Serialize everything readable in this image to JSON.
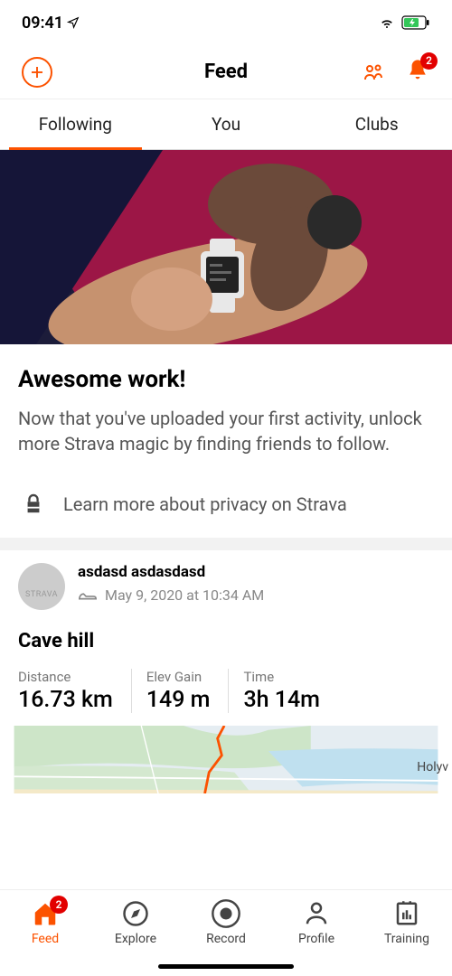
{
  "status": {
    "time": "09:41"
  },
  "header": {
    "title": "Feed",
    "notification_count": "2"
  },
  "tabs": {
    "following": "Following",
    "you": "You",
    "clubs": "Clubs"
  },
  "promo": {
    "title": "Awesome work!",
    "body": "Now that you've uploaded your first activity, unlock more Strava magic by finding friends to follow.",
    "privacy": "Learn more about privacy on Strava"
  },
  "activity": {
    "avatar_text": "STRAVA",
    "user": "asdasd asdasdasd",
    "timestamp": "May 9, 2020 at 10:34 AM",
    "title": "Cave hill",
    "stats": {
      "distance_label": "Distance",
      "distance_value": "16.73 km",
      "elev_label": "Elev Gain",
      "elev_value": "149 m",
      "time_label": "Time",
      "time_value": "3h 14m"
    },
    "map_label": "Holyv"
  },
  "nav": {
    "feed": "Feed",
    "feed_badge": "2",
    "explore": "Explore",
    "record": "Record",
    "profile": "Profile",
    "training": "Training"
  }
}
